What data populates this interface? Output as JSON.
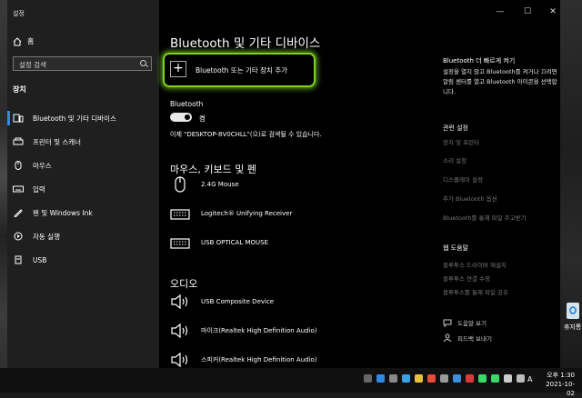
{
  "window": {
    "title": "설정"
  },
  "sidebar": {
    "home": "홈",
    "search_placeholder": "설정 검색",
    "section": "장치",
    "items": [
      {
        "label": "Bluetooth 및 기타 디바이스",
        "icon": "bluetooth-devices-icon"
      },
      {
        "label": "프린터 및 스캐너",
        "icon": "printer-icon"
      },
      {
        "label": "마우스",
        "icon": "mouse-icon"
      },
      {
        "label": "입력",
        "icon": "keyboard-icon"
      },
      {
        "label": "펜 및 Windows Ink",
        "icon": "pen-icon"
      },
      {
        "label": "자동 실행",
        "icon": "autoplay-icon"
      },
      {
        "label": "USB",
        "icon": "usb-icon"
      }
    ]
  },
  "main": {
    "title": "Bluetooth 및 기타 디바이스",
    "add_device": "Bluetooth 또는 기타 장치 추가",
    "bluetooth_label": "Bluetooth",
    "toggle_state": "켬",
    "discover_text": "이제 \"DESKTOP-8V0CHLL\"(으)로 검색될 수 있습니다.",
    "mouse_section": "마우스, 키보드 및 펜",
    "mouse_devices": [
      {
        "name": "2.4G Mouse",
        "icon": "mouse-icon"
      },
      {
        "name": "Logitech® Unifying Receiver",
        "icon": "keyboard-icon"
      },
      {
        "name": "USB OPTICAL MOUSE",
        "icon": "keyboard-icon"
      }
    ],
    "audio_section": "오디오",
    "audio_devices": [
      {
        "name": "USB Composite Device",
        "icon": "speaker-icon"
      },
      {
        "name": "마이크(Realtek High Definition Audio)",
        "icon": "speaker-icon"
      },
      {
        "name": "스피커(Realtek High Definition Audio)",
        "icon": "speaker-icon"
      }
    ]
  },
  "right_panel": {
    "quick_title": "Bluetooth 더 빠르게 켜기",
    "quick_text": "설정을 열지 않고 Bluetooth를 켜거나 끄려면 알림 센터를 열고 Bluetooth 아이콘을 선택합니다.",
    "related_title": "관련 설정",
    "related_links": [
      "장치 및 프린터",
      "소리 설정",
      "디스플레이 설정",
      "추가 Bluetooth 옵션",
      "Bluetooth를 통해 파일 주고받기"
    ],
    "web_help_title": "웹 도움말",
    "web_help_links": [
      "블루투스 드라이버 재설치",
      "블루투스 연결 수정",
      "블루투스를 통해 파일 공유"
    ],
    "get_help": "도움말 보기",
    "feedback": "피드백 보내기"
  },
  "desktop": {
    "recycle_label": "휴지통"
  },
  "taskbar": {
    "language": "A",
    "time": "오후 1:30",
    "date": "2021-10-02"
  },
  "colors": {
    "accent": "#2f8ae5",
    "highlight": "#7ed321"
  }
}
